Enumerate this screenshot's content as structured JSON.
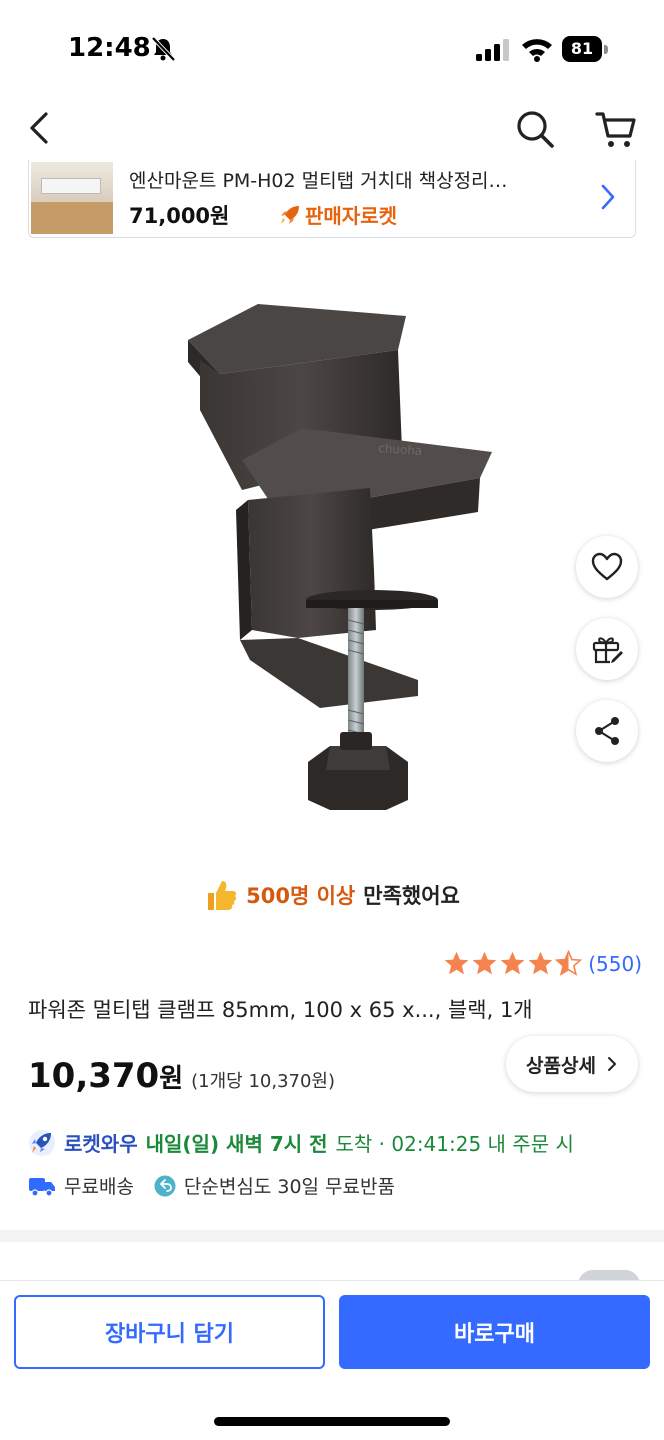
{
  "status_bar": {
    "time": "12:48",
    "battery": "81"
  },
  "related_product": {
    "title": "엔산마운트 PM-H02 멀티탭 거치대 책상정리…",
    "price": "71,000원",
    "badge": "판매자로켓"
  },
  "floating_actions": {
    "detail_label": "상품상세"
  },
  "satisfaction": {
    "highlight": "500명 이상",
    "rest": "만족했어요"
  },
  "rating": {
    "stars": 4.5,
    "count": "(550)"
  },
  "product": {
    "title": "파워존 멀티탭 클램프 85mm, 100 x 65 x..., 블랙, 1개",
    "price": "10,370",
    "price_won": "원",
    "unit_price": "(1개당 10,370원)"
  },
  "delivery": {
    "label": "로켓와우",
    "date": "내일(일) 새벽 7시 전",
    "arrive": "도착 · 02:41:25  내 주문 시"
  },
  "shipping": {
    "free_shipping": "무료배송",
    "free_return": "단순변심도 30일 무료반품"
  },
  "bottom": {
    "cart_label": "장바구니 담기",
    "buy_label": "바로구매"
  },
  "colors": {
    "accent": "#346aff",
    "rocket_orange": "#e5640d",
    "star": "#f5834f",
    "delivery_green": "#1a8a3a"
  }
}
